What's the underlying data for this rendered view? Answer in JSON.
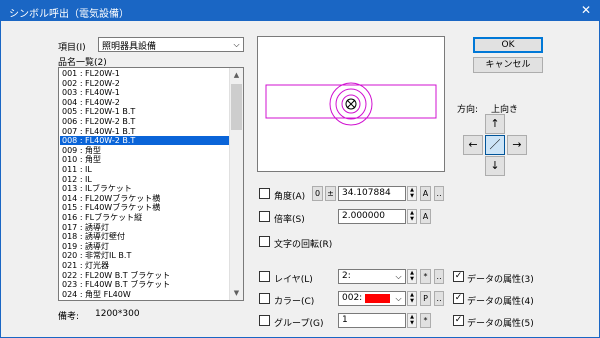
{
  "window": {
    "title": "シンボル呼出（電気設備）"
  },
  "item": {
    "label": "項目(I)",
    "value": "照明器具設備"
  },
  "partlist": {
    "label": "品名一覧(2)",
    "items": [
      "001 : FL20W-1",
      "002 : FL20W-2",
      "003 : FL40W-1",
      "004 : FL40W-2",
      "005 : FL20W-1 B.T",
      "006 : FL20W-2 B.T",
      "007 : FL40W-1 B.T",
      "008 : FL40W-2 B.T",
      "009 : 角型",
      "010 : 角型",
      "011 : IL",
      "012 : IL",
      "013 : ILブラケット",
      "014 : FL20Wブラケット横",
      "015 : FL40Wブラケット横",
      "016 : FLブラケット縦",
      "017 : 誘導灯",
      "018 : 誘導灯壁付",
      "019 : 誘導灯",
      "020 : 非常灯IL B.T",
      "021 : 灯光器",
      "022 : FL20W B.T ブラケット",
      "023 : FL40W B.T ブラケット",
      "024 : 角型 FL40W"
    ],
    "selected_index": 7
  },
  "remark": {
    "label": "備考:",
    "value": "1200*300"
  },
  "buttons": {
    "ok": "OK",
    "cancel": "キャンセル"
  },
  "direction": {
    "label": "方向:",
    "value": "上向き",
    "arrows": {
      "up": "↑",
      "left": "←",
      "center": "／",
      "right": "→",
      "down": "↓"
    }
  },
  "angle": {
    "label": "角度(A)",
    "zero": "0",
    "pm": "±",
    "value": "34.107884",
    "checked": false
  },
  "scale": {
    "label": "倍率(S)",
    "value": "2.000000",
    "checked": false
  },
  "rotate_text": {
    "label": "文字の回転(R)",
    "checked": false
  },
  "layer": {
    "label": "レイヤ(L)",
    "value": "2:",
    "checked": false
  },
  "color": {
    "label": "カラー(C)",
    "value": "002:",
    "swatch": "#ff0000",
    "checked": false
  },
  "group": {
    "label": "グループ(G)",
    "value": "1",
    "checked": false
  },
  "attr": [
    {
      "label": "データの属性(3)",
      "checked": true
    },
    {
      "label": "データの属性(4)",
      "checked": true
    },
    {
      "label": "データの属性(5)",
      "checked": true
    }
  ],
  "small_btns": {
    "a": "A",
    "star": "*",
    "p": "P",
    "dots": "‥"
  },
  "colors": {
    "title": "#1a66c4",
    "selection": "#0a64d8",
    "symbol": "#d010d0"
  }
}
